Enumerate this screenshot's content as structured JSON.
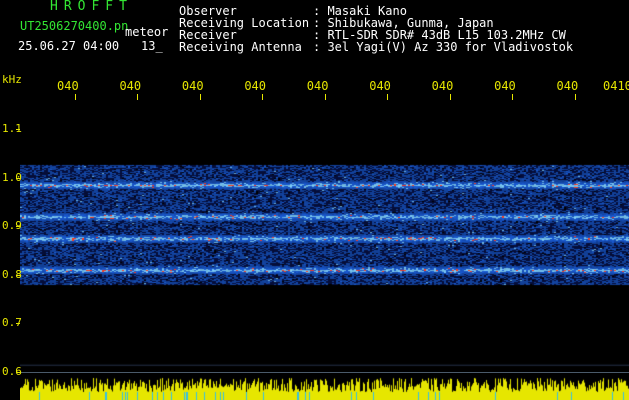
{
  "header": {
    "brand": "HROFFT",
    "file_name": "UT2506270400.pn",
    "file_ext": "meteor",
    "datetime": "25.06.27 04:00",
    "count": "13_"
  },
  "info": [
    {
      "label": "Observer",
      "value": ": Masaki Kano"
    },
    {
      "label": "Receiving Location",
      "value": ": Shibukawa, Gunma, Japan"
    },
    {
      "label": "Receiver",
      "value": ": RTL-SDR SDR# 43dB L15 103.2MHz CW"
    },
    {
      "label": "Receiving Antenna",
      "value": ": 3el Yagi(V) Az 330 for Vladivostok"
    }
  ],
  "chart_data": {
    "type": "heatmap",
    "ylabel": "kHz",
    "y_ticks": [
      "1.1",
      "1.0",
      "0.9",
      "0.8",
      "0.7",
      "0.6"
    ],
    "y_tick_values": [
      1.1,
      1.0,
      0.9,
      0.8,
      0.7,
      0.6
    ],
    "ylim": [
      0.6,
      1.16
    ],
    "x_ticks": [
      "040",
      "040",
      "040",
      "040",
      "040",
      "040",
      "040",
      "040",
      "040",
      "0410"
    ],
    "signal_band_khz": [
      0.78,
      1.025
    ],
    "bright_lines_khz": [
      0.985,
      0.92,
      0.875,
      0.81
    ],
    "colors": {
      "background": "#000000",
      "low": "#0a1a6e",
      "mid": "#1e6cff",
      "high": "#ff3a1a",
      "power_trace": "#e6e600",
      "text_header": "#33e633",
      "text_axis": "#e6e600"
    }
  }
}
